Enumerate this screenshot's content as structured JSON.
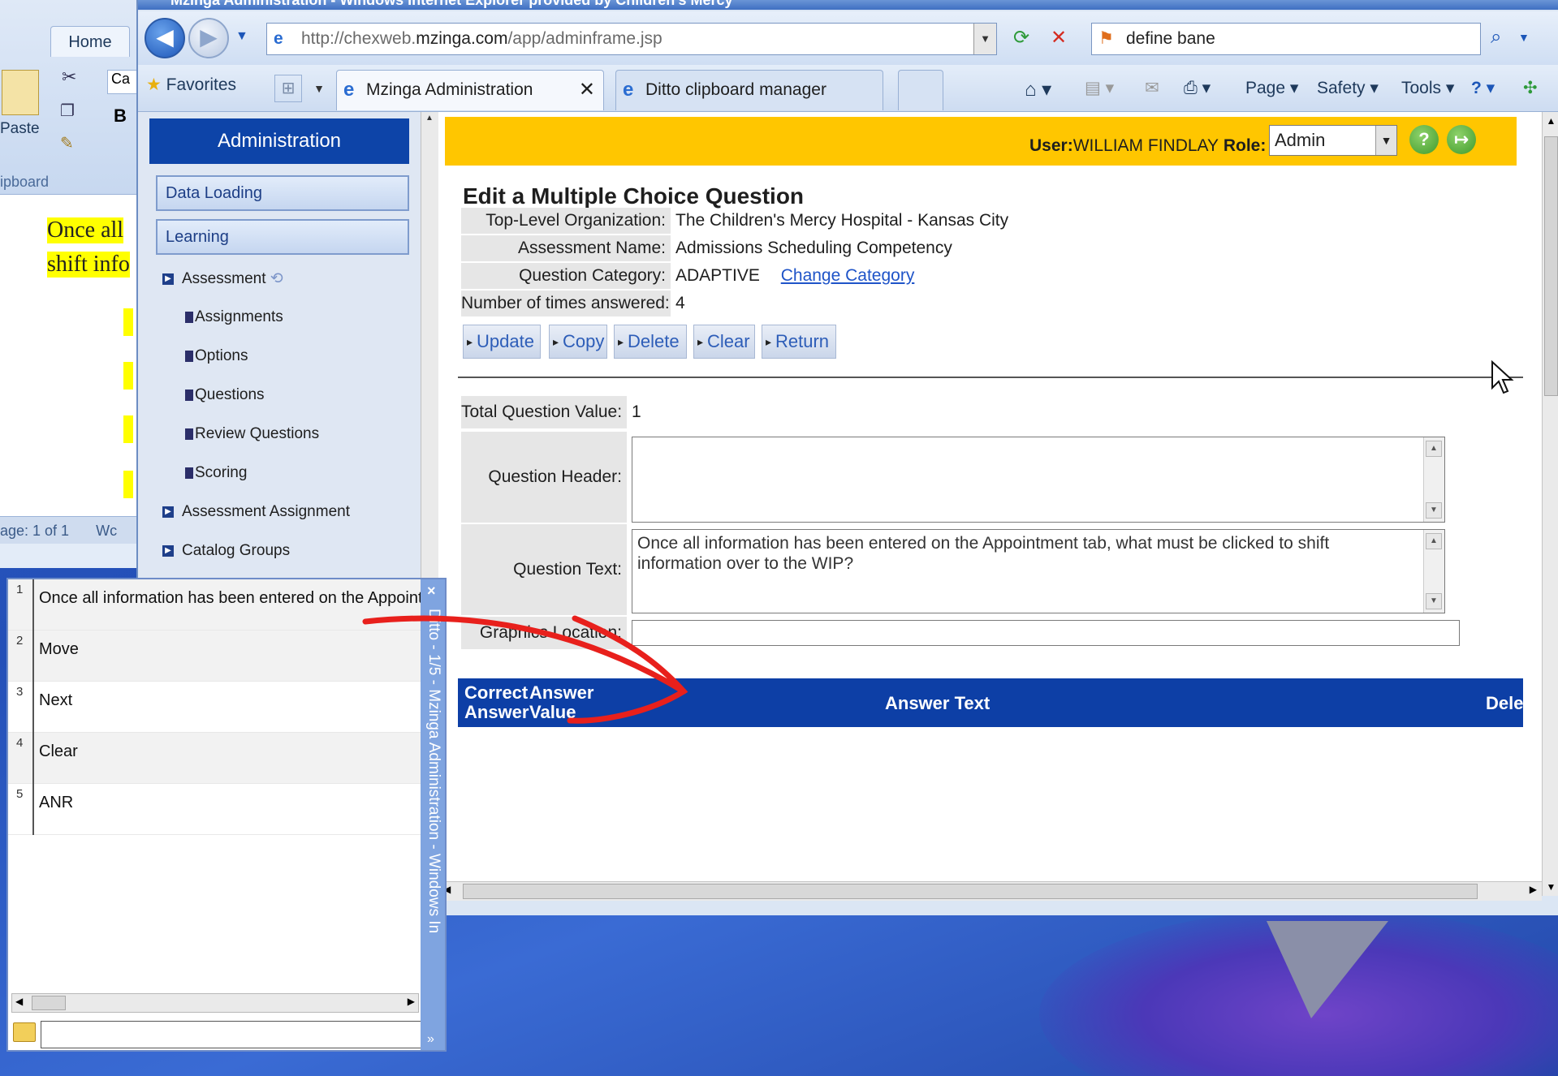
{
  "window": {
    "title": "Mzinga Administration - Windows Internet Explorer provided by Children's Mercy"
  },
  "word": {
    "home_tab": "Home",
    "paste_label": "Paste",
    "clipboard_group": "ipboard",
    "doc_line1": "Once all",
    "doc_line2": "shift info",
    "status_page": "age: 1 of 1",
    "status_words": "Wc"
  },
  "browser": {
    "url_prefix": "http://chexweb.",
    "url_domain": "mzinga.com",
    "url_path": "/app/adminframe.jsp",
    "search_value": "define bane",
    "favorites_label": "Favorites",
    "tabs": [
      {
        "label": "Mzinga Administration",
        "active": true
      },
      {
        "label": "Ditto clipboard manager",
        "active": false
      }
    ],
    "commands": {
      "page": "Page",
      "safety": "Safety",
      "tools": "Tools"
    }
  },
  "sidebar": {
    "header": "Administration",
    "menu_boxes": [
      "Data Loading",
      "Learning"
    ],
    "assessment": "Assessment",
    "sub_items": [
      "Assignments",
      "Options",
      "Questions",
      "Review Questions",
      "Scoring"
    ],
    "assessment_assignment": "Assessment Assignment",
    "catalog_groups": "Catalog Groups"
  },
  "userbar": {
    "user_label": "User:",
    "user_name": "WILLIAM FINDLAY",
    "role_label": "Role:",
    "role_value": "Admin"
  },
  "form": {
    "title": "Edit a Multiple Choice Question",
    "fields": [
      {
        "label": "Top-Level Organization:",
        "value": "The Children's Mercy Hospital - Kansas City"
      },
      {
        "label": "Assessment Name:",
        "value": "Admissions Scheduling Competency"
      },
      {
        "label": "Question Category:",
        "value": "ADAPTIVE"
      },
      {
        "label": "Number of times answered:",
        "value": "4"
      }
    ],
    "change_category": "Change Category",
    "buttons": [
      "Update",
      "Copy",
      "Delete",
      "Clear",
      "Return"
    ],
    "total_value_label": "Total Question Value:",
    "total_value": "1",
    "question_header_label": "Question Header:",
    "question_header_value": "",
    "question_text_label": "Question Text:",
    "question_text_value": "Once all information has been entered on the Appointment tab, what must be clicked to shift information over to the WIP?",
    "graphics_location_label": "Graphics Location:",
    "graphics_location_value": ""
  },
  "answers_table": {
    "col_correct_1": "Correct",
    "col_correct_2": "Answer",
    "col_value_1": "Answer",
    "col_value_2": "Value",
    "col_text": "Answer Text",
    "col_delete": "Delete"
  },
  "ditto": {
    "side_title": "Ditto - 1/5 - Mzinga Administration - Windows In",
    "clips": [
      {
        "num": "1",
        "text": "Once all information has been entered on the Appointment tab"
      },
      {
        "num": "2",
        "text": "Move"
      },
      {
        "num": "3",
        "text": "Next"
      },
      {
        "num": "4",
        "text": "Clear"
      },
      {
        "num": "5",
        "text": "ANR"
      }
    ]
  },
  "colors": {
    "admin_blue": "#0d44a8",
    "user_bar": "#ffc600",
    "table_head": "#0d3fa6",
    "annotation_red": "#e8201c"
  }
}
